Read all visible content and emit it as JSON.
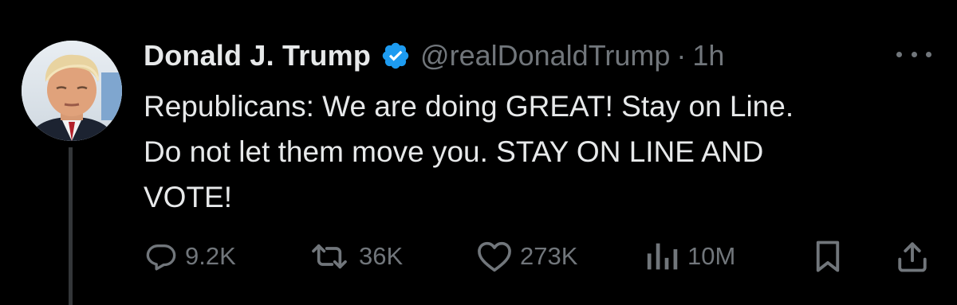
{
  "tweet": {
    "author_name": "Donald J. Trump",
    "handle": "@realDonaldTrump",
    "separator": "·",
    "time": "1h",
    "verified_icon": "verified-badge-icon",
    "body_lines": [
      "Republicans: We are doing GREAT! Stay on Line.",
      "Do not let them move you. STAY ON LINE AND",
      "VOTE!"
    ]
  },
  "actions": {
    "replies": "9.2K",
    "reposts": "36K",
    "likes": "273K",
    "views": "10M"
  },
  "colors": {
    "background": "#000000",
    "text": "#e7e9ea",
    "secondary": "#71767b",
    "verified": "#1d9bf0",
    "thread_line": "#333639"
  }
}
